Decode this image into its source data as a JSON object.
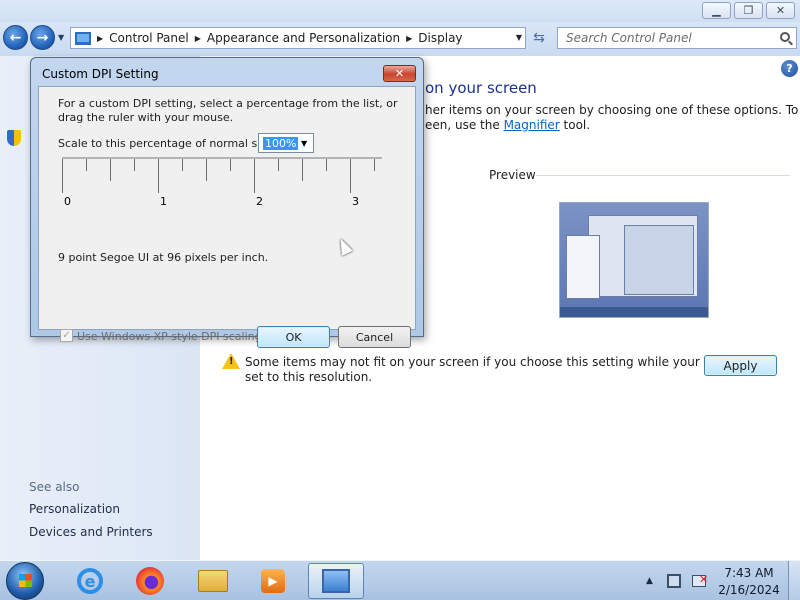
{
  "window": {
    "breadcrumbs": [
      "Control Panel",
      "Appearance and Personalization",
      "Display"
    ],
    "search_placeholder": "Search Control Panel"
  },
  "left_pane": {
    "see_also_label": "See also",
    "links": [
      "Personalization",
      "Devices and Printers"
    ]
  },
  "main": {
    "heading_fragment": "on your screen",
    "desc_line1": "her items on your screen by choosing one of these options. To",
    "desc_line2_prefix": "een, use the ",
    "magnifier_link": "Magnifier",
    "desc_line2_suffix": " tool.",
    "preview_label": "Preview",
    "warning_line1": "Some items may not fit on your screen if you choose this setting while your display is",
    "warning_line2": "set to this resolution.",
    "apply_button": "Apply"
  },
  "dialog": {
    "title": "Custom DPI Setting",
    "desc_line1": "For a custom DPI setting, select a percentage from the list, or",
    "desc_line2": "drag the ruler with your mouse.",
    "scale_label": "Scale to this percentage of normal size:",
    "scale_value": "100%",
    "ruler_labels": [
      "0",
      "1",
      "2",
      "3"
    ],
    "font_info": "9 point Segoe UI at 96 pixels per inch.",
    "xp_scaling_label": "Use Windows XP style DPI scaling",
    "xp_scaling_checked": true,
    "ok_button": "OK",
    "cancel_button": "Cancel"
  },
  "taskbar": {
    "apps": [
      "internet-explorer",
      "firefox",
      "windows-explorer",
      "media-player",
      "control-panel"
    ],
    "active_app": "control-panel",
    "time": "7:43 AM",
    "date": "2/16/2024"
  },
  "colors": {
    "heading": "#1e3287",
    "link": "#0066cc",
    "taskbar": "#a9c2e0",
    "dialog_frame": "#aec8e6"
  }
}
